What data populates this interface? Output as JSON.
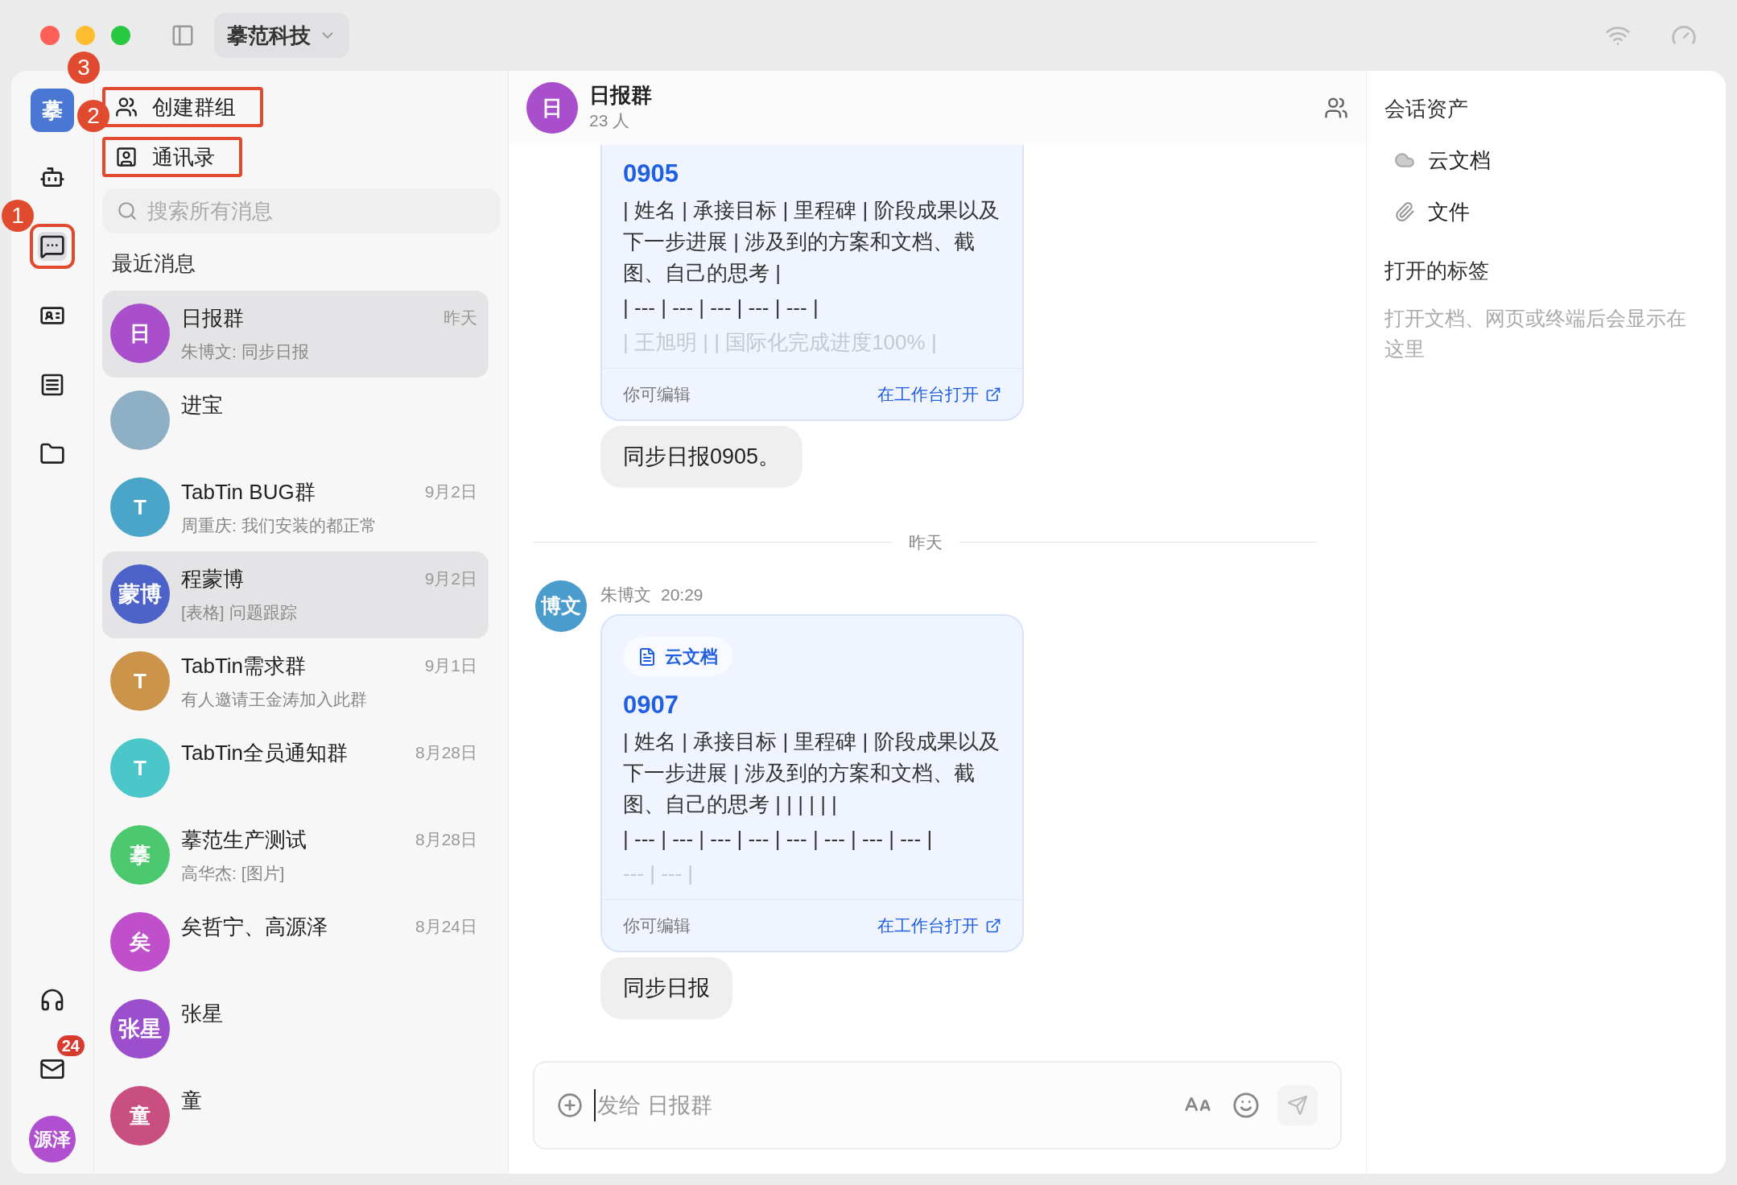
{
  "window": {
    "workspace": "摹范科技"
  },
  "annotations": [
    {
      "label": "3"
    },
    {
      "label": "2"
    },
    {
      "label": "1"
    }
  ],
  "rail": {
    "logo": "摹",
    "items": [
      {
        "kind": "robot",
        "selected": false,
        "annotated": false
      },
      {
        "kind": "chat",
        "selected": true,
        "annotated": true
      },
      {
        "kind": "card",
        "selected": false,
        "annotated": false
      },
      {
        "kind": "list",
        "selected": false,
        "annotated": false
      },
      {
        "kind": "folder",
        "selected": false,
        "annotated": false
      }
    ],
    "bottom": [
      {
        "kind": "headphones"
      },
      {
        "kind": "mail",
        "badge": "24"
      }
    ],
    "user_avatar": {
      "text": "源泽",
      "color": "#b04fd0"
    }
  },
  "chat_list": {
    "actions": [
      {
        "kind": "group",
        "label": "创建群组",
        "annotated": true
      },
      {
        "kind": "contacts",
        "label": "通讯录",
        "annotated": true
      }
    ],
    "search": {
      "placeholder": "搜索所有消息"
    },
    "section_title": "最近消息",
    "items": [
      {
        "name": "日报群",
        "preview": "朱博文: 同步日报",
        "time": "昨天",
        "avatar": {
          "kind": "initial",
          "text": "日",
          "color": "#a94fcc"
        },
        "selected": true
      },
      {
        "name": "进宝",
        "avatar": {
          "kind": "photo"
        },
        "selected": false
      },
      {
        "name": "TabTin BUG群",
        "preview": "周重庆: 我们安装的都正常",
        "time": "9月2日",
        "avatar": {
          "kind": "initial",
          "text": "T",
          "color": "#4aa5c9"
        },
        "selected": false
      },
      {
        "name": "程蒙博",
        "preview": "[表格] 问题跟踪",
        "time": "9月2日",
        "avatar": {
          "kind": "initial",
          "text": "蒙博",
          "color": "#4c62c9"
        },
        "selected": true
      },
      {
        "name": "TabTin需求群",
        "preview": "有人邀请王金涛加入此群",
        "time": "9月1日",
        "avatar": {
          "kind": "initial",
          "text": "T",
          "color": "#cc934a"
        },
        "selected": false
      },
      {
        "name": "TabTin全员通知群",
        "time": "8月28日",
        "avatar": {
          "kind": "initial",
          "text": "T",
          "color": "#4cc7c9"
        },
        "selected": false
      },
      {
        "name": "摹范生产测试",
        "preview": "高华杰: [图片]",
        "time": "8月28日",
        "avatar": {
          "kind": "initial",
          "text": "摹",
          "color": "#4cc96e"
        },
        "selected": false
      },
      {
        "name": "矣哲宁、高源泽",
        "time": "8月24日",
        "avatar": {
          "kind": "initial",
          "text": "矣",
          "color": "#c04fcc"
        },
        "selected": false
      },
      {
        "name": "张星",
        "avatar": {
          "kind": "initial",
          "text": "张星",
          "color": "#9b4fcc"
        },
        "selected": false
      },
      {
        "name": "童",
        "avatar": {
          "kind": "initial",
          "text": "童",
          "color": "#c94f80"
        },
        "selected": false
      }
    ]
  },
  "conversation": {
    "title": "日报群",
    "members": "23 人",
    "avatar": {
      "text": "日",
      "color": "#a94fcc"
    },
    "messages": [
      {
        "kind": "card",
        "title": "0905",
        "lines": [
          {
            "text": "| 姓名 | 承接目标 | 里程碑 | 阶段成果以及下一步进展 | 涉及到的方案和文档、截图、自己的思考 |",
            "faded": false
          },
          {
            "text": "| --- | --- | --- | --- | --- |",
            "faded": false
          },
          {
            "text": "| 王旭明 | | 国际化完成进度100% |",
            "faded": true
          }
        ],
        "footer_note": "你可编辑",
        "footer_link": "在工作台打开"
      },
      {
        "kind": "text",
        "text": "同步日报0905。"
      },
      {
        "kind": "divider",
        "text": "昨天"
      },
      {
        "kind": "sender",
        "name": "朱博文",
        "time": "20:29",
        "avatar": {
          "text": "博文",
          "color": "#4a9ccc"
        }
      },
      {
        "kind": "card",
        "chip": "云文档",
        "title": "0907",
        "lines": [
          {
            "text": "| 姓名 | 承接目标 | 里程碑 | 阶段成果以及下一步进展 | 涉及到的方案和文档、截图、自己的思考 | | | | | |",
            "faded": false
          },
          {
            "text": "| --- | --- | --- | --- | --- | --- | --- | --- |",
            "faded": false
          },
          {
            "text": "--- | --- |",
            "faded": true
          }
        ],
        "footer_note": "你可编辑",
        "footer_link": "在工作台打开"
      },
      {
        "kind": "text",
        "text": "同步日报"
      }
    ],
    "composer": {
      "placeholder": "发给 日报群"
    }
  },
  "assets_panel": {
    "title": "会话资产",
    "items": [
      {
        "kind": "cloud",
        "label": "云文档"
      },
      {
        "kind": "file",
        "label": "文件"
      }
    ],
    "tabs_title": "打开的标签",
    "tabs_empty": "打开文档、网页或终端后会显示在这里"
  }
}
